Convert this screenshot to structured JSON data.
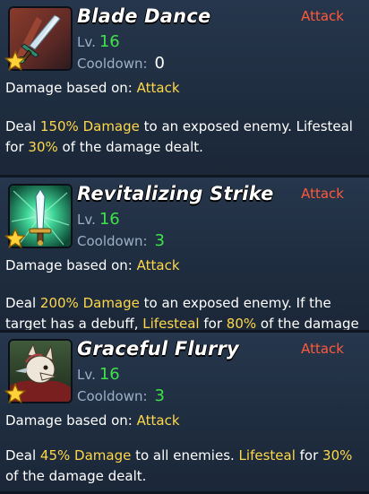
{
  "cards": [
    {
      "name": "Blade Dance",
      "type": "Attack",
      "lv_label": "Lv.",
      "lv_value": "16",
      "cooldown_label": "Cooldown:",
      "cooldown_value": "0",
      "damage_basis_label": "Damage based on:",
      "damage_basis_value": "Attack",
      "icon": "sword-icon",
      "description": [
        {
          "text": "Deal ",
          "highlight": false
        },
        {
          "text": "150%",
          "highlight": true
        },
        {
          "text": " ",
          "highlight": false
        },
        {
          "text": "Damage",
          "highlight": true
        },
        {
          "text": " to an exposed enemy. Lifesteal for ",
          "highlight": false
        },
        {
          "text": "30%",
          "highlight": true
        },
        {
          "text": " of the damage dealt.",
          "highlight": false
        }
      ]
    },
    {
      "name": "Revitalizing Strike",
      "type": "Attack",
      "lv_label": "Lv.",
      "lv_value": "16",
      "cooldown_label": "Cooldown:",
      "cooldown_value": "3",
      "damage_basis_label": "Damage based on:",
      "damage_basis_value": "Attack",
      "icon": "glowing-sword-icon",
      "description": [
        {
          "text": "Deal ",
          "highlight": false
        },
        {
          "text": "200%",
          "highlight": true
        },
        {
          "text": " ",
          "highlight": false
        },
        {
          "text": "Damage",
          "highlight": true
        },
        {
          "text": " to an exposed enemy. If the target has a debuff, ",
          "highlight": false
        },
        {
          "text": "Lifesteal",
          "highlight": true
        },
        {
          "text": " for ",
          "highlight": false
        },
        {
          "text": "80%",
          "highlight": true
        },
        {
          "text": " of the damage dealt.",
          "highlight": false
        }
      ]
    },
    {
      "name": "Graceful Flurry",
      "type": "Attack",
      "lv_label": "Lv.",
      "lv_value": "16",
      "cooldown_label": "Cooldown:",
      "cooldown_value": "3",
      "damage_basis_label": "Damage based on:",
      "damage_basis_value": "Attack",
      "icon": "fox-warrior-icon",
      "description": [
        {
          "text": "Deal ",
          "highlight": false
        },
        {
          "text": "45%",
          "highlight": true
        },
        {
          "text": " ",
          "highlight": false
        },
        {
          "text": "Damage",
          "highlight": true
        },
        {
          "text": " to all enemies. ",
          "highlight": false
        },
        {
          "text": "Lifesteal",
          "highlight": true
        },
        {
          "text": " for ",
          "highlight": false
        },
        {
          "text": "30%",
          "highlight": true
        },
        {
          "text": " of the damage dealt.",
          "highlight": false
        }
      ]
    }
  ],
  "colors": {
    "highlight": "#ffd84a",
    "type_attack": "#ff5a3c",
    "level_green": "#3fe24a",
    "label_muted": "#9eb0c6",
    "panel_bg": "#22324a"
  }
}
